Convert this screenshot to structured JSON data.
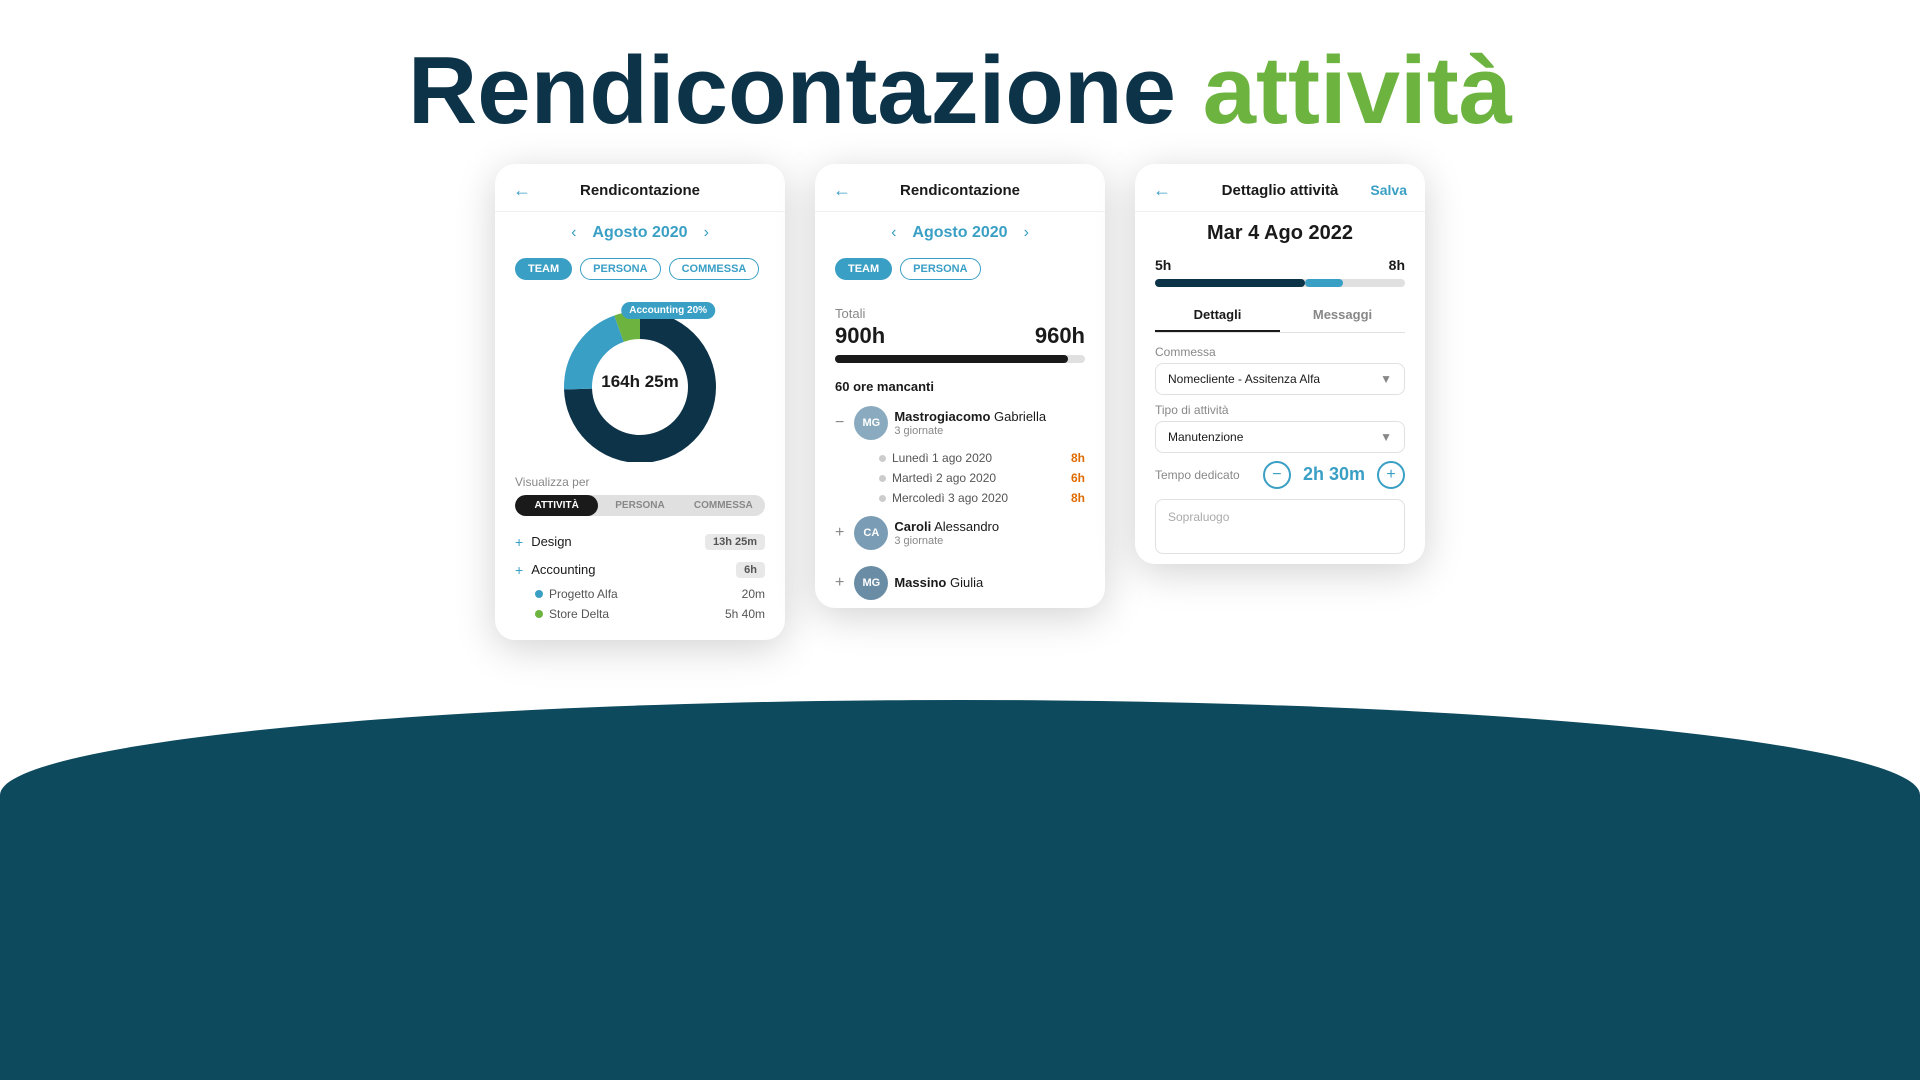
{
  "hero": {
    "title_dark": "Rendicontazione",
    "title_green": "attività"
  },
  "card1": {
    "header_title": "Rendicontazione",
    "month": "Agosto 2020",
    "filters": [
      "TEAM",
      "PERSONA",
      "COMMESSA"
    ],
    "active_filter": "TEAM",
    "donut_bubble": "Accounting  20%",
    "donut_center": "164h 25m",
    "visualizza_label": "Visualizza per",
    "seg_options": [
      "ATTIVITÀ",
      "PERSONA",
      "COMMESSA"
    ],
    "active_seg": "ATTIVITÀ",
    "activities": [
      {
        "name": "Design",
        "time": "13h 25m",
        "has_plus": true
      },
      {
        "name": "Accounting",
        "time": "6h",
        "has_plus": true
      }
    ],
    "sub_activities": [
      {
        "name": "Progetto Alfa",
        "time": "20m",
        "color": "#3a9fc4"
      },
      {
        "name": "Store Delta",
        "time": "5h 40m",
        "color": "#6db33f"
      }
    ]
  },
  "card2": {
    "header_title": "Rendicontazione",
    "month": "Agosto 2020",
    "filters": [
      "TEAM",
      "PERSONA"
    ],
    "active_filter": "TEAM",
    "totali_label": "Totali",
    "totali_current": "900h",
    "totali_max": "960h",
    "totali_pct": 93,
    "mancanti": "60 ore mancanti",
    "persons": [
      {
        "name_last": "Mastrogiacomo",
        "name_first": "Gabriella",
        "giornate": "3 giornate",
        "days": [
          {
            "label": "Lunedì 1 ago 2020",
            "hours": "8h"
          },
          {
            "label": "Martedì 2 ago 2020",
            "hours": "6h"
          },
          {
            "label": "Mercoledì 3 ago 2020",
            "hours": "8h"
          }
        ],
        "avatar_initials": "MG",
        "avatar_color": "#8aabbf"
      },
      {
        "name_last": "Caroli",
        "name_first": "Alessandro",
        "giornate": "3 giornate",
        "days": [],
        "avatar_initials": "CA",
        "avatar_color": "#7a9db5"
      },
      {
        "name_last": "Massino",
        "name_first": "Giulia",
        "giornate": "",
        "days": [],
        "avatar_initials": "MG",
        "avatar_color": "#6a8da5"
      }
    ]
  },
  "card3": {
    "header_title": "Dettaglio attività",
    "save_label": "Salva",
    "date": "Mar 4 Ago 2022",
    "time_current": "5h",
    "time_max": "8h",
    "tabs": [
      "Dettagli",
      "Messaggi"
    ],
    "active_tab": "Dettagli",
    "commessa_label": "Commessa",
    "commessa_value": "Nomecliente - Assitenza Alfa",
    "tipo_label": "Tipo di attività",
    "tipo_value": "Manutenzione",
    "tempo_label": "Tempo dedicato",
    "tempo_value": "2h 30m",
    "note_placeholder": "Sopraluogo"
  }
}
